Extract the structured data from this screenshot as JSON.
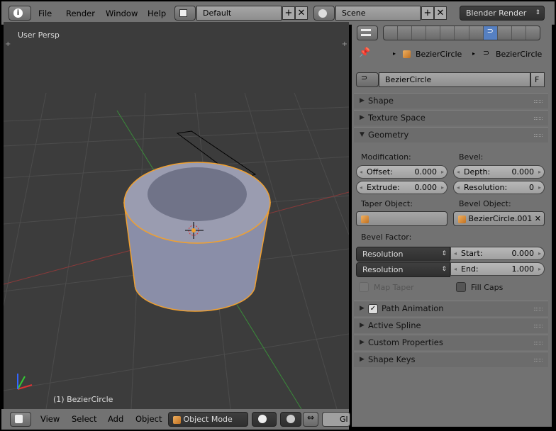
{
  "topbar": {
    "menus": [
      "File",
      "Render",
      "Window",
      "Help"
    ],
    "layout": "Default",
    "scene": "Scene",
    "engine": "Blender Render"
  },
  "viewport": {
    "view_label": "User Persp",
    "object_label": "(1) BezierCircle"
  },
  "viewport_header": {
    "menus": [
      "View",
      "Select",
      "Add",
      "Object"
    ],
    "mode": "Object Mode",
    "gl_label": "Gl"
  },
  "properties": {
    "breadcrumb": [
      "BezierCircle",
      "BezierCircle"
    ],
    "datablock": "BezierCircle",
    "fake_user": "F",
    "panels": {
      "shape": "Shape",
      "texture_space": "Texture Space",
      "geometry": "Geometry",
      "path_animation": "Path Animation",
      "active_spline": "Active Spline",
      "custom_properties": "Custom Properties",
      "shape_keys": "Shape Keys"
    },
    "geometry": {
      "modification_label": "Modification:",
      "bevel_label": "Bevel:",
      "offset_label": "Offset:",
      "offset": "0.000",
      "extrude_label": "Extrude:",
      "extrude": "0.000",
      "depth_label": "Depth:",
      "depth": "0.000",
      "resolution_label": "Resolution:",
      "resolution": "0",
      "taper_object_label": "Taper Object:",
      "bevel_object_label": "Bevel Object:",
      "bevel_object": "BezierCircle.001",
      "bevel_factor_label": "Bevel Factor:",
      "start_mode": "Resolution",
      "start_label": "Start:",
      "start": "0.000",
      "end_mode": "Resolution",
      "end_label": "End:",
      "end": "1.000",
      "map_taper": "Map Taper",
      "fill_caps": "Fill Caps"
    }
  },
  "colors": {
    "selection": "#f0a030",
    "active_tab": "#5680c2"
  }
}
